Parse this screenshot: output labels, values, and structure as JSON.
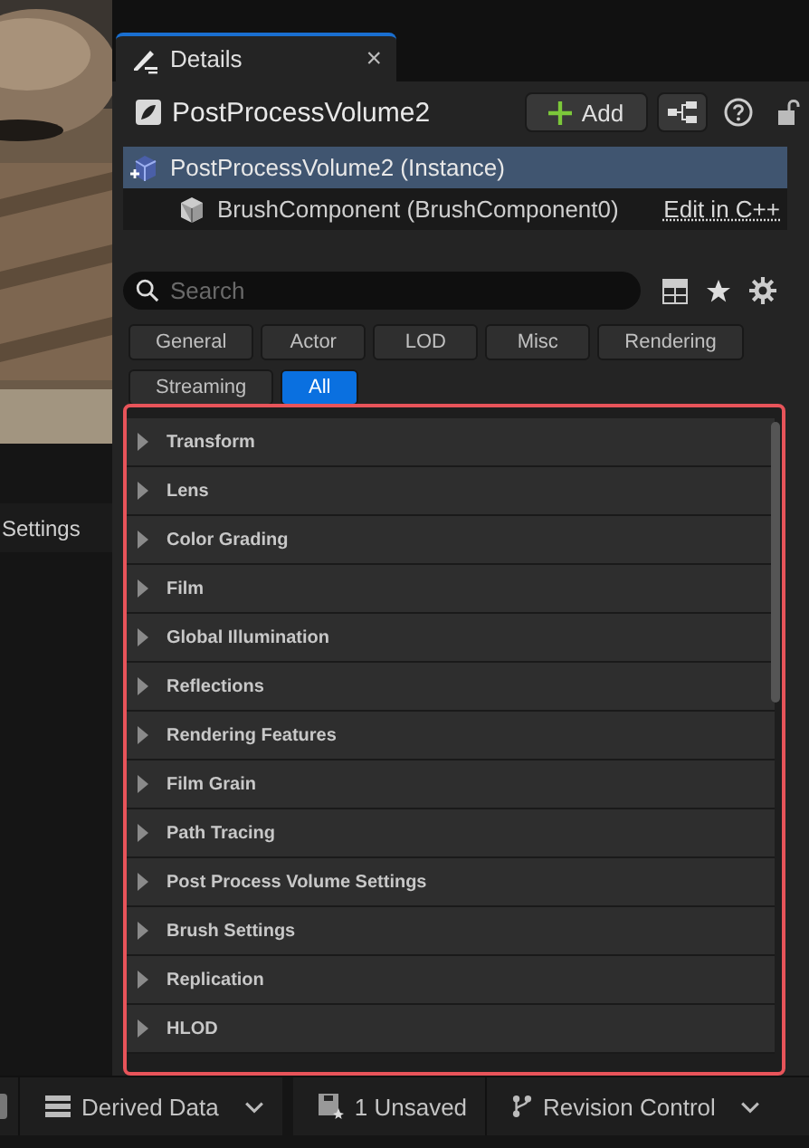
{
  "left_panel": {
    "label": "Settings"
  },
  "details": {
    "tab": {
      "title": "Details",
      "close": "×"
    },
    "actor": {
      "name": "PostProcessVolume2",
      "add_button": "Add"
    },
    "components": [
      {
        "label": "PostProcessVolume2 (Instance)",
        "selected": true
      },
      {
        "label": "BrushComponent (BrushComponent0)",
        "selected": false,
        "link": "Edit in C++"
      }
    ],
    "search": {
      "placeholder": "Search"
    },
    "filters": [
      {
        "label": "General",
        "selected": false
      },
      {
        "label": "Actor",
        "selected": false
      },
      {
        "label": "LOD",
        "selected": false
      },
      {
        "label": "Misc",
        "selected": false
      },
      {
        "label": "Rendering",
        "selected": false
      },
      {
        "label": "Streaming",
        "selected": false
      },
      {
        "label": "All",
        "selected": true
      }
    ],
    "categories": [
      {
        "label": "Transform",
        "expanded": false
      },
      {
        "label": "Lens",
        "expanded": false
      },
      {
        "label": "Color Grading",
        "expanded": false
      },
      {
        "label": "Film",
        "expanded": false
      },
      {
        "label": "Global Illumination",
        "expanded": false
      },
      {
        "label": "Reflections",
        "expanded": false
      },
      {
        "label": "Rendering Features",
        "expanded": false
      },
      {
        "label": "Film Grain",
        "expanded": false
      },
      {
        "label": "Path Tracing",
        "expanded": false
      },
      {
        "label": "Post Process Volume Settings",
        "expanded": false
      },
      {
        "label": "Brush Settings",
        "expanded": false
      },
      {
        "label": "Replication",
        "expanded": false
      },
      {
        "label": "HLOD",
        "expanded": false
      }
    ]
  },
  "status_bar": {
    "derived_data": "Derived Data",
    "unsaved": "1 Unsaved",
    "revision_control": "Revision Control"
  }
}
